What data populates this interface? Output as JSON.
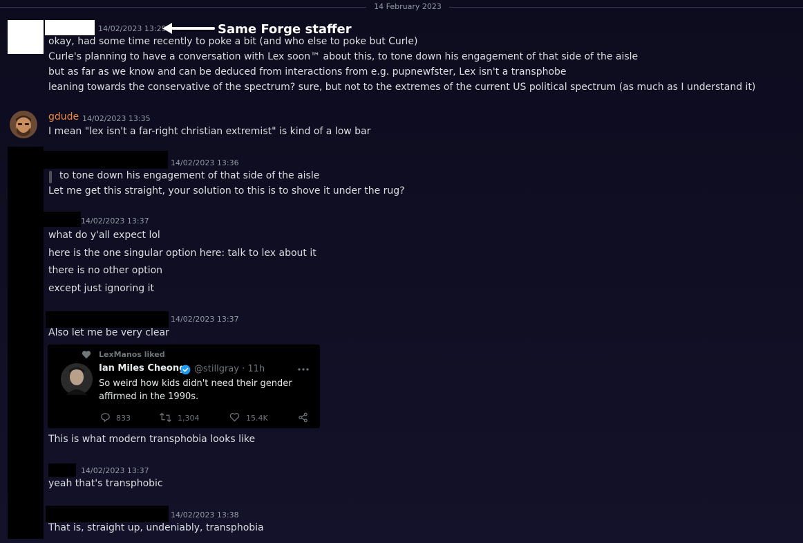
{
  "date_divider": "14 February 2023",
  "annotation": {
    "label": "Same Forge staffer"
  },
  "messages": {
    "m1": {
      "timestamp": "14/02/2023 13:29",
      "lines": [
        "okay, had some time recently to poke a bit (and who else to poke but Curle)",
        "Curle's planning to have a conversation with Lex soon™ about this, to tone down his engagement of that side of the aisle",
        "but as far as we know and can be deduced from interactions from e.g. pupnewfster, Lex isn't a transphobe",
        "leaning towards the conservative of the spectrum? sure, but not to the extremes of the current US political spectrum (as much as I understand it)"
      ]
    },
    "m2": {
      "username": "gdude",
      "timestamp": "14/02/2023 13:35",
      "lines": [
        "I mean \"lex isn't a far-right christian extremist\" is kind of a low bar"
      ]
    },
    "m3": {
      "timestamp": "14/02/2023 13:36",
      "quote": "to tone down his engagement of that side of the aisle",
      "lines": [
        "Let me get this straight, your solution to this is to shove it under the rug?"
      ]
    },
    "m4": {
      "timestamp": "14/02/2023 13:37",
      "lines": [
        "what do y'all expect lol",
        "here is the one singular option here: talk to lex about it",
        "there is no other option",
        "except just ignoring it"
      ]
    },
    "m5": {
      "timestamp": "14/02/2023 13:37",
      "lines": [
        "Also let me be very clear"
      ],
      "embed": {
        "liked_by": "LexManos liked",
        "author_name": "Ian Miles Cheong",
        "author_handle": "@stillgray · 11h",
        "text_lines": [
          "So weird how kids didn't need their gender",
          "affirmed in the 1990s."
        ],
        "replies": "833",
        "reposts": "1,304",
        "likes": "15.4K"
      },
      "after_lines": [
        "This is what modern transphobia looks like"
      ]
    },
    "m6": {
      "timestamp": "14/02/2023 13:37",
      "lines": [
        "yeah that's transphobic"
      ]
    },
    "m7": {
      "timestamp": "14/02/2023 13:38",
      "lines": [
        "That is, straight up, undeniably, transphobia"
      ]
    }
  },
  "colors": {
    "background": "#100e22",
    "username_gdude": "#f0873c",
    "verified": "#1d9bf0"
  }
}
